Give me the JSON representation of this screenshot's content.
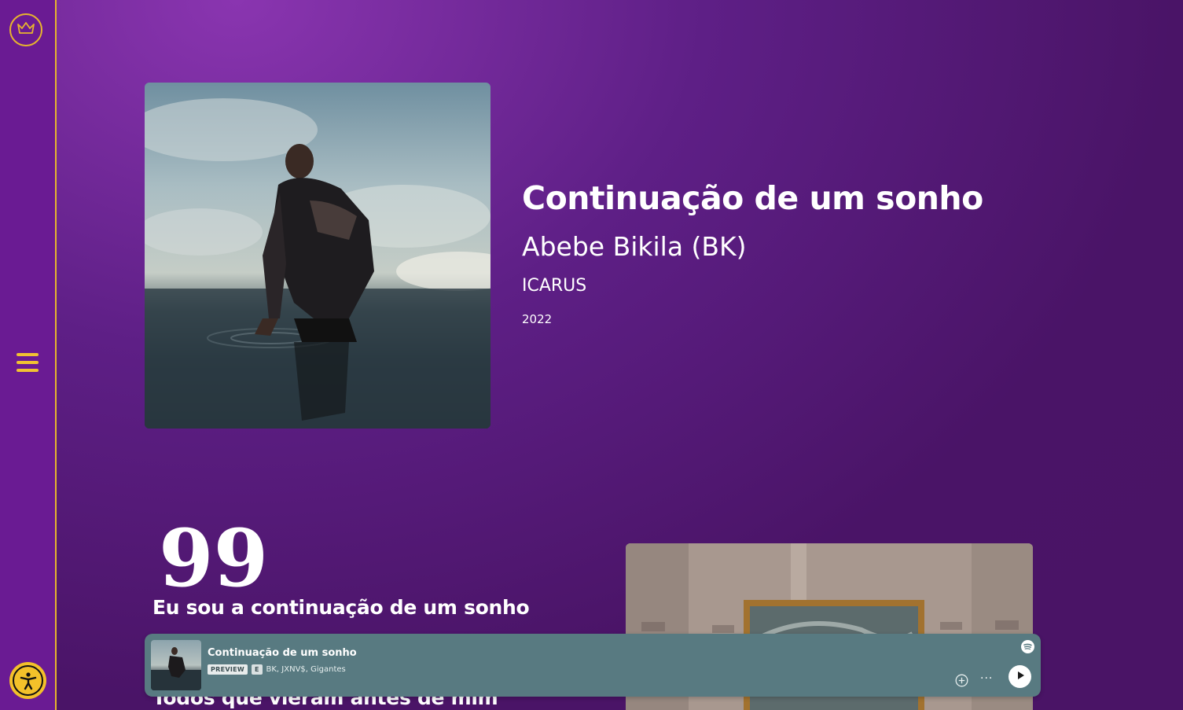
{
  "colors": {
    "accent": "#e7b52d",
    "sidebar": "#6a1b93",
    "background": "#4a1466",
    "player": "#587a81"
  },
  "sidebar": {
    "logo_icon": "crown-icon",
    "menu_icon": "hamburger-menu-icon",
    "accessibility_icon": "accessibility-icon"
  },
  "song": {
    "title": "Continuação de um sonho",
    "artist": "Abebe Bikila (BK)",
    "album": "ICARUS",
    "year": "2022"
  },
  "quote": {
    "mark": "99",
    "line_1": "Eu sou a continuação de um sonho",
    "line_2": "Todos que vieram antes de mim"
  },
  "player": {
    "title": "Continuação de um sonho",
    "preview_badge": "PREVIEW",
    "explicit_badge": "E",
    "artists": "BK, JXNV$, Gigantes",
    "more_label": "···"
  }
}
